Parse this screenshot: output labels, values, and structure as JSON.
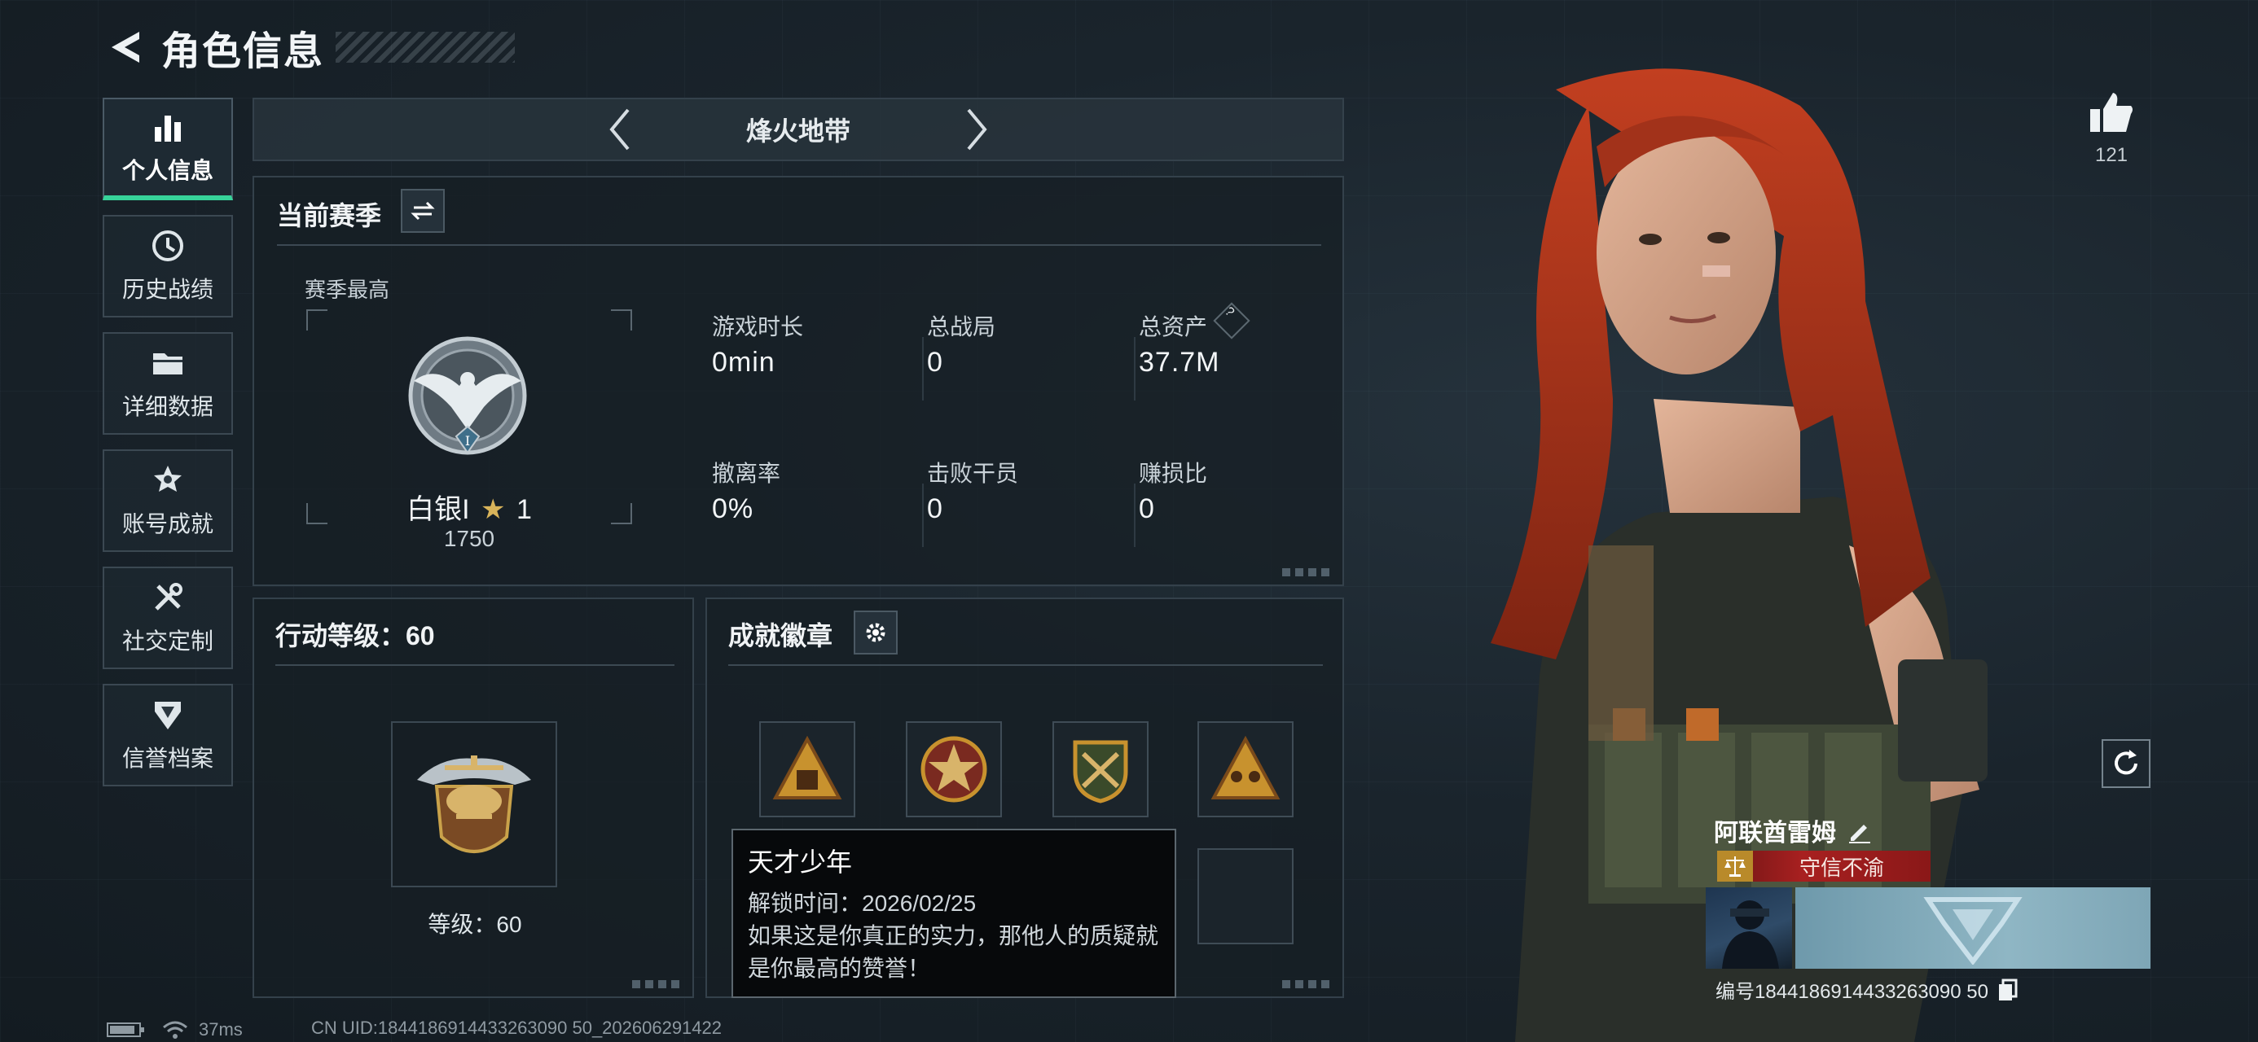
{
  "header": {
    "title": "角色信息"
  },
  "sidebar": {
    "items": [
      {
        "label": "个人信息",
        "icon": "bar-chart-icon",
        "active": true
      },
      {
        "label": "历史战绩",
        "icon": "history-clock-icon",
        "active": false
      },
      {
        "label": "详细数据",
        "icon": "folder-icon",
        "active": false
      },
      {
        "label": "账号成就",
        "icon": "medal-icon",
        "active": false
      },
      {
        "label": "社交定制",
        "icon": "tools-icon",
        "active": false
      },
      {
        "label": "信誉档案",
        "icon": "shield-badge-icon",
        "active": false
      }
    ]
  },
  "mode": {
    "name": "烽火地带"
  },
  "season": {
    "title": "当前赛季",
    "best_label": "赛季最高",
    "rank_name": "白银I",
    "rank_stars": "1",
    "rank_points": "1750",
    "stats": [
      {
        "label": "游戏时长",
        "value": "0min"
      },
      {
        "label": "总战局",
        "value": "0"
      },
      {
        "label": "总资产",
        "value": "37.7M",
        "help": "?"
      },
      {
        "label": "撤离率",
        "value": "0%"
      },
      {
        "label": "击败干员",
        "value": "0"
      },
      {
        "label": "赚损比",
        "value": "0"
      }
    ]
  },
  "action_level": {
    "title": "行动等级：60",
    "level_text": "等级：60"
  },
  "achievements": {
    "title": "成就徽章",
    "tooltip": {
      "title": "天才少年",
      "unlock": "解锁时间：2026/02/25",
      "desc_line1": "如果这是你真正的实力，那他人的质疑就",
      "desc_line2": "是你最高的赞誉！"
    }
  },
  "profile": {
    "likes": "121",
    "player_name": "阿联酋雷姆",
    "title_tag": "守信不渝",
    "player_id": "编号1844186914433263090 50"
  },
  "status": {
    "ping": "37ms",
    "uid": "CN UID:1844186914433263090 50_202606291422"
  },
  "colors": {
    "accent_green": "#37d39a",
    "title_red": "#a82020",
    "hair": "#b5361c"
  }
}
